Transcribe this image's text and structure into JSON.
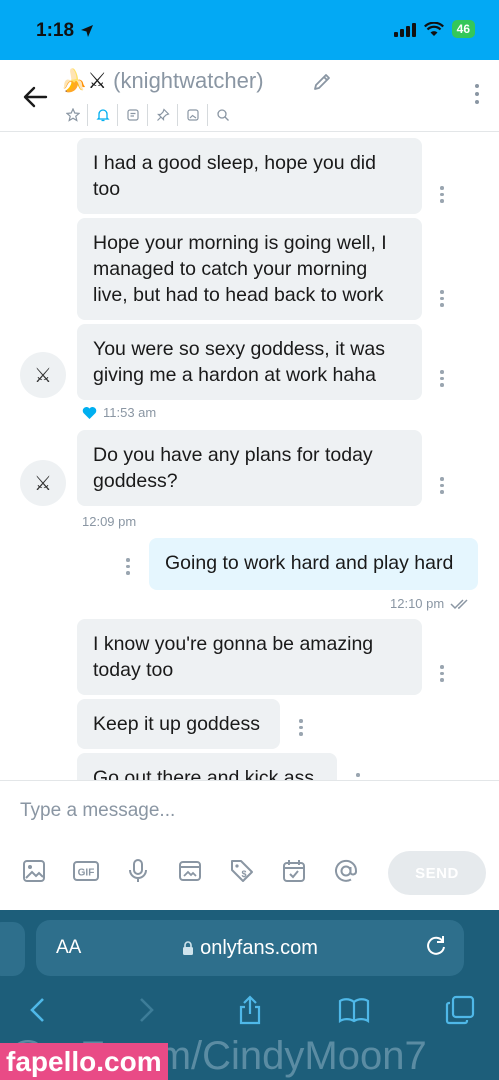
{
  "status_bar": {
    "time": "1:18",
    "battery": "46"
  },
  "header": {
    "title_emoji": "🍌⚔",
    "username": "(knightwatcher)"
  },
  "messages": [
    {
      "text": "I had a good sleep, hope you did too"
    },
    {
      "text": "Hope your morning is going well, I managed to catch your morning live, but had to head back to work"
    },
    {
      "text": "You were so sexy goddess, it was giving me a hardon at work haha"
    },
    {
      "time": "11:53 am"
    },
    {
      "text": "Do you have any plans for today goddess?"
    },
    {
      "time": "12:09 pm"
    },
    {
      "text": "Going to work hard and play hard"
    },
    {
      "time": "12:10 pm"
    },
    {
      "text": "I know you're gonna be amazing today too"
    },
    {
      "text": "Keep it up goddess"
    },
    {
      "text": "Go out there and kick ass"
    }
  ],
  "avatar_glyph": "⚔",
  "composer": {
    "placeholder": "Type a message...",
    "send_label": "SEND"
  },
  "browser": {
    "aa_label": "AA",
    "url": "onlyfans.com"
  },
  "watermark": {
    "url_text": "@  .  F     .c m/CindyMoon7",
    "badge": "fapello.com"
  },
  "colors": {
    "status_bar": "#03a9f4",
    "incoming_bubble": "#eef1f3",
    "outgoing_bubble": "#e5f6fe",
    "accent": "#00aff0",
    "browser": "#1d5e7a",
    "watermark_badge": "#e94b86"
  }
}
